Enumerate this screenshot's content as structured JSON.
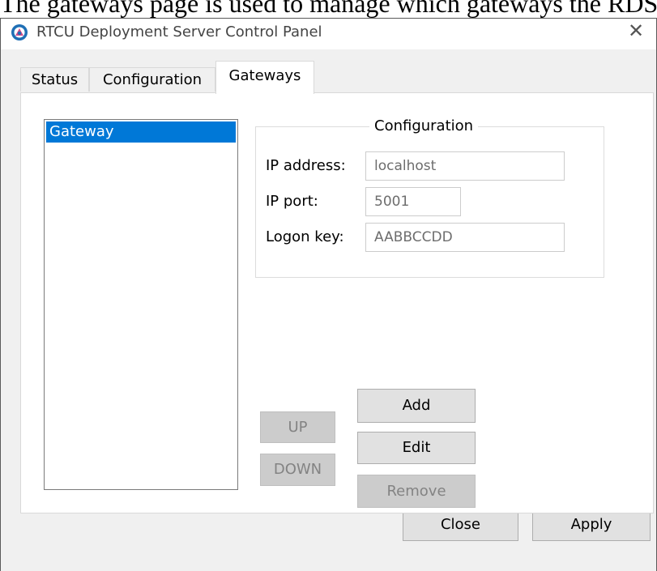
{
  "caption": "The gateways page is used to manage which gateways the RDS",
  "window": {
    "title": "RTCU Deployment Server Control Panel",
    "close_glyph": "✕"
  },
  "tabs": [
    {
      "label": "Status",
      "active": false
    },
    {
      "label": "Configuration",
      "active": false
    },
    {
      "label": "Gateways",
      "active": true
    }
  ],
  "gateway_list": {
    "items": [
      "Gateway"
    ],
    "selected": "Gateway"
  },
  "configuration": {
    "legend": "Configuration",
    "fields": [
      {
        "label": "IP address:",
        "value": "localhost"
      },
      {
        "label": "IP port:",
        "value": "5001"
      },
      {
        "label": "Logon key:",
        "value": "AABBCCDD"
      }
    ]
  },
  "actions": {
    "up": "UP",
    "down": "DOWN",
    "add": "Add",
    "edit": "Edit",
    "remove": "Remove"
  },
  "footer": {
    "close": "Close",
    "apply": "Apply"
  },
  "colors": {
    "selection": "#0078d7",
    "disabled_button": "#cccccc",
    "button": "#e1e1e1"
  },
  "icons": {
    "app": "rtcu-app-icon",
    "close": "close-icon"
  }
}
